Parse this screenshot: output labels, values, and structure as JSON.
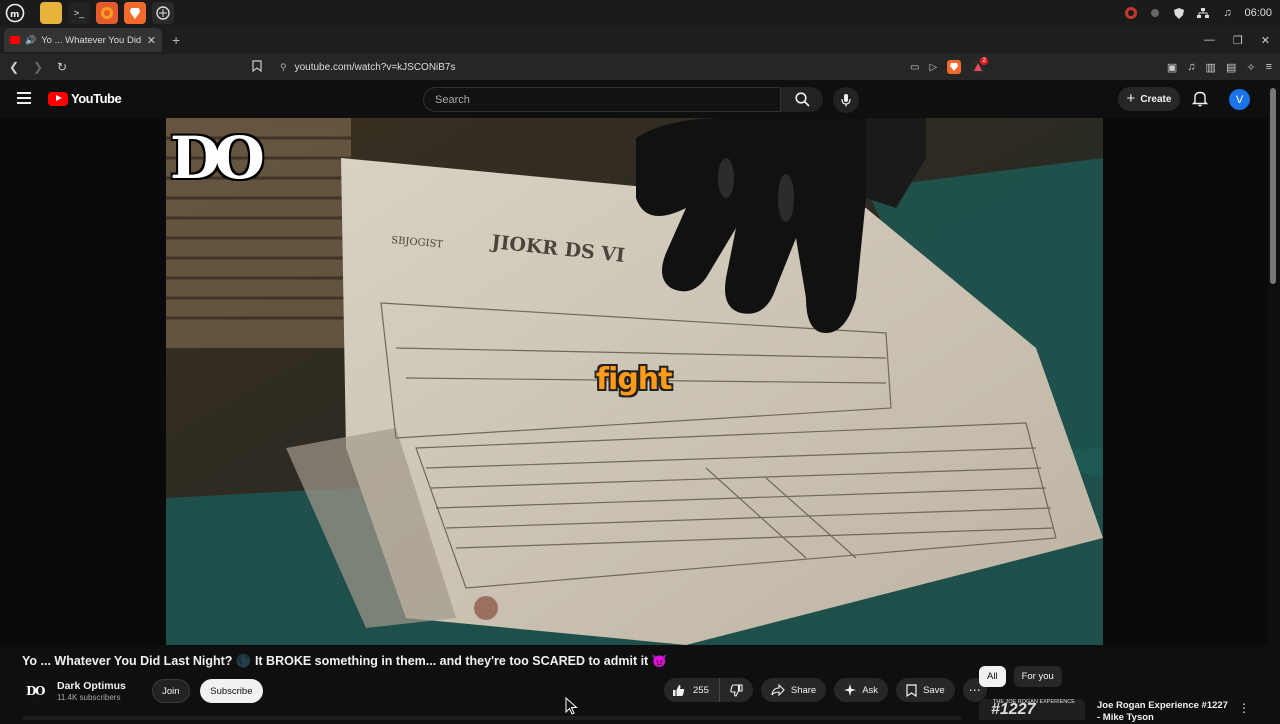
{
  "os": {
    "clock": "06:00"
  },
  "browser": {
    "tab_title": "Yo ... Whatever You Did La",
    "url": "youtube.com/watch?v=kJSCONiB7s",
    "ext_badge": "2"
  },
  "youtube": {
    "logo_text": "YouTube",
    "search_placeholder": "Search",
    "create_label": "Create",
    "avatar_letter": "V"
  },
  "video": {
    "watermark": "DO",
    "caption": "fight",
    "title": "Yo ... Whatever You Did Last Night? 🌑 It BROKE something in them... and they're too SCARED to admit it 😈"
  },
  "channel": {
    "avatar_text": "DO",
    "name": "Dark Optimus",
    "subscribers": "11.4K subscribers",
    "join_label": "Join",
    "subscribe_label": "Subscribe"
  },
  "actions": {
    "likes": "255",
    "share_label": "Share",
    "ask_label": "Ask",
    "save_label": "Save"
  },
  "sidebar": {
    "chips": [
      "All",
      "For you"
    ],
    "recommended": {
      "thumb_text": "#1227",
      "thumb_small": "THE JOE ROGAN EXPERIENCE",
      "title": "Joe Rogan Experience #1227 - Mike Tyson"
    }
  },
  "colors": {
    "background": "#0f0f0f",
    "yt_red": "#ff0000",
    "caption_orange": "#ff9b1a",
    "avatar_blue": "#1a73e8"
  }
}
